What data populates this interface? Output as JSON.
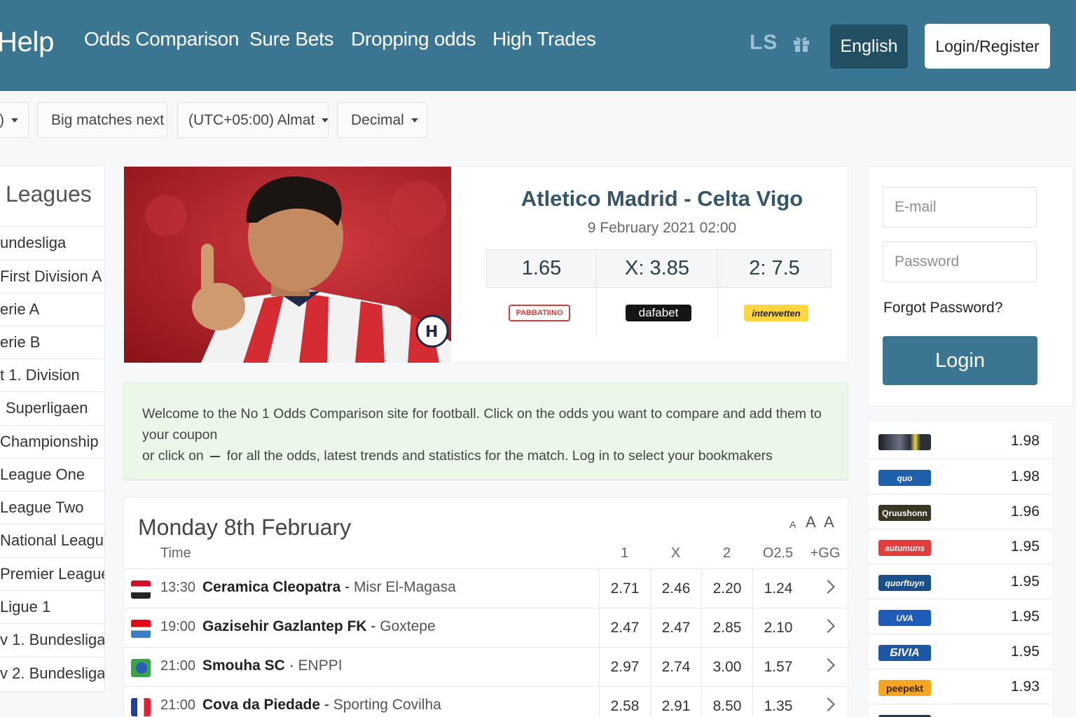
{
  "header": {
    "nav": [
      "Help",
      "Odds Comparison",
      "Sure Bets",
      "Dropping odds",
      "High Trades"
    ],
    "logo_text": "LS",
    "gift_icon": "gift-icon",
    "language_button": "English",
    "login_register_button": "Login/Register"
  },
  "filters": {
    "sport_partial": ")",
    "sort": "Big matches next",
    "timezone": "(UTC+05:00) Almat",
    "odds_format": "Decimal"
  },
  "leagues": {
    "title": "Leagues",
    "items": [
      "undesliga",
      "First Division A",
      "erie A",
      "erie B",
      "t 1. Division",
      "Superligaen",
      "Championship",
      "League One",
      "League Two",
      "National League",
      "Premier League",
      "Ligue 1",
      "v 1. Bundesliga",
      "v 2. Bundesliga"
    ]
  },
  "featured": {
    "title": "Atletico Madrid - Celta Vigo",
    "date": "9 February 2021 02:00",
    "odds": [
      "1.65",
      "X: 3.85",
      "2: 7.5"
    ],
    "bookmakers": [
      "PABBATIINO",
      "dafabet",
      "interwetten"
    ]
  },
  "welcome": {
    "line1": "Welcome to the No 1 Odds Comparison site for football. Click on the odds you want to compare and add them to your coupon",
    "line2_a": "or click on",
    "line2_b": "for all the odds, latest trends and statistics for the match. Log in to select your bookmakers"
  },
  "matches": {
    "day": "Monday 8th February",
    "font_sizes": [
      "A",
      "A",
      "A"
    ],
    "columns": [
      "Time",
      "1",
      "X",
      "2",
      "O2.5",
      "+GG"
    ],
    "rows": [
      {
        "time": "13:30",
        "home": "Ceramica Cleopatra",
        "away": "Misr El-Magasa",
        "sep": " - ",
        "o1": "2.71",
        "ox": "2.46",
        "o2": "2.20",
        "ou": "1.24"
      },
      {
        "time": "19:00",
        "home": "Gazisehir Gazlantep FK",
        "away": "Goxtepe",
        "sep": " - ",
        "o1": "2.47",
        "ox": "2.47",
        "o2": "2.85",
        "ou": "2.10"
      },
      {
        "time": "21:00",
        "home": "Smouha SC",
        "away": "ENPPI",
        "sep": " · ",
        "o1": "2.97",
        "ox": "2.74",
        "o2": "3.00",
        "ou": "1.57"
      },
      {
        "time": "21:00",
        "home": "Cova da Piedade",
        "away": "Sporting Covilha",
        "sep": " - ",
        "o1": "2.58",
        "ox": "2.91",
        "o2": "8.50",
        "ou": "1.35"
      }
    ]
  },
  "login": {
    "email_placeholder": "E-mail",
    "password_placeholder": "Password",
    "forgot": "Forgot Password?",
    "button": "Login"
  },
  "bookie_odds": [
    {
      "logo": "",
      "odd": "1.98",
      "color": "#2a2f38"
    },
    {
      "logo": "quo",
      "odd": "1.98",
      "color": "#1d5fa8"
    },
    {
      "logo": "Qruushonn",
      "odd": "1.96",
      "color": "#3b3522"
    },
    {
      "logo": "autumuns",
      "odd": "1.95",
      "color": "#e23c3c"
    },
    {
      "logo": "quorftuyn",
      "odd": "1.95",
      "color": "#1b4f8a"
    },
    {
      "logo": "UVA",
      "odd": "1.95",
      "color": "#1f5bb8"
    },
    {
      "logo": "БIVIA",
      "odd": "1.95",
      "color": "#1c58a6"
    },
    {
      "logo": "peepekt",
      "odd": "1.93",
      "color": "#f5a623"
    }
  ]
}
